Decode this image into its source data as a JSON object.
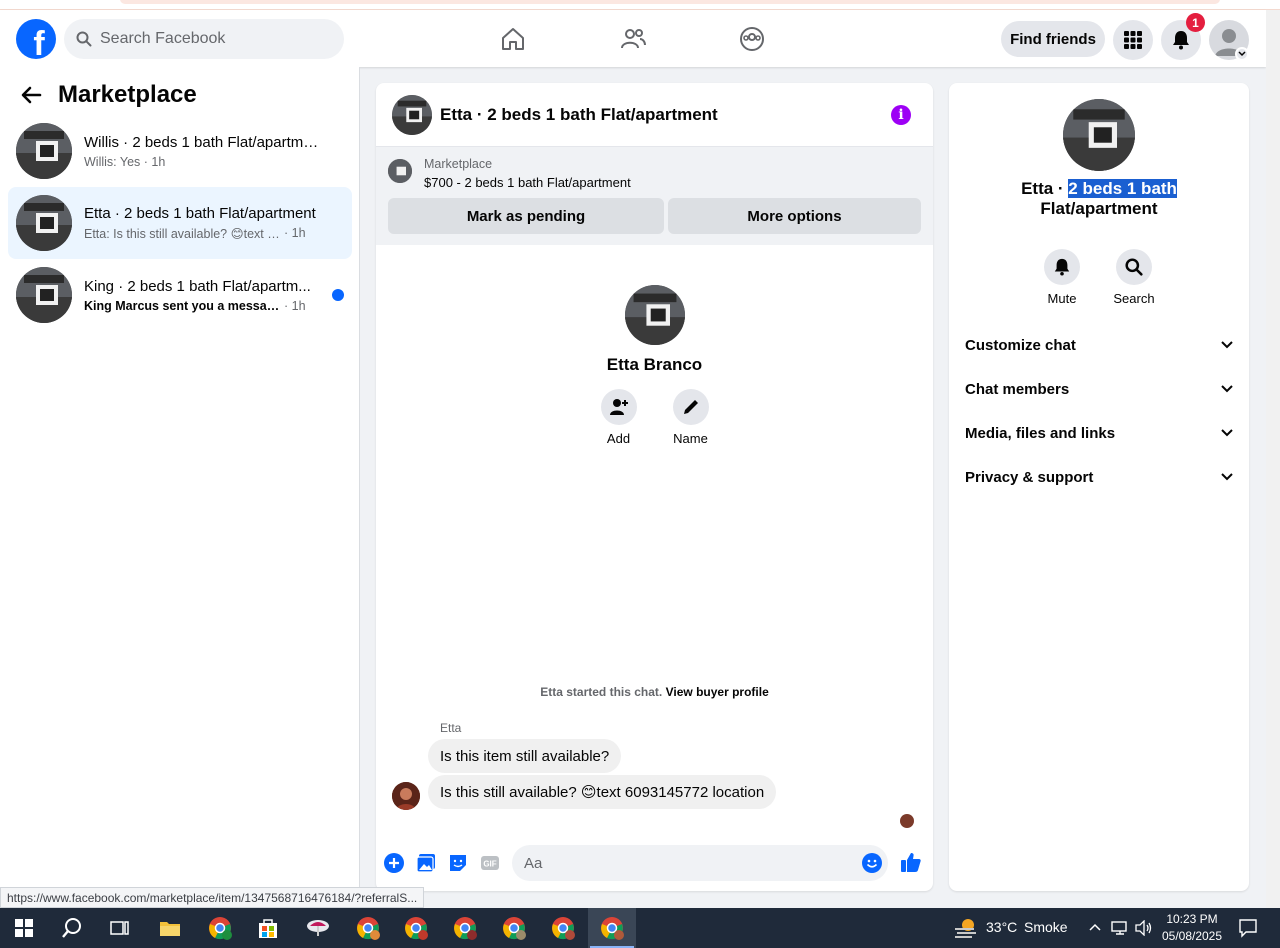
{
  "header": {
    "logo": "f",
    "search_placeholder": "Search Facebook",
    "find_friends": "Find friends",
    "notification_count": "1"
  },
  "sidebar": {
    "title": "Marketplace",
    "conversations": [
      {
        "title": "Willis · 2 beds 1 bath Flat/apartment",
        "subtitle": "Willis: Yes · 1h",
        "active": false,
        "unread": false
      },
      {
        "title": "Etta · 2 beds 1 bath Flat/apartment",
        "subtitle": "Etta: Is this still available? 😊text 609...",
        "time": " · 1h",
        "active": true,
        "unread": false
      },
      {
        "title": "King · 2 beds 1 bath Flat/apartm...",
        "subtitle": "King Marcus sent you a message a...",
        "time": " · 1h",
        "active": false,
        "unread": true
      }
    ]
  },
  "chat": {
    "title": "Etta · 2 beds 1 bath Flat/apartment",
    "listing_label": "Marketplace",
    "listing_price": "$700 - 2 beds 1 bath Flat/apartment",
    "mark_pending": "Mark as pending",
    "more_options": "More options",
    "profile_name": "Etta Branco",
    "add_label": "Add",
    "name_label": "Name",
    "started_text": "Etta started this chat.",
    "view_profile": "View buyer profile",
    "sender": "Etta",
    "messages": [
      "Is this item still available?",
      "Is this still available? 😊text 6093145772 location"
    ],
    "composer_placeholder": "Aa"
  },
  "details": {
    "title_prefix": "Etta · ",
    "title_selected": "2 beds 1 bath",
    "title_suffix": "Flat/apartment",
    "mute": "Mute",
    "search": "Search",
    "sections": [
      "Customize chat",
      "Chat members",
      "Media, files and links",
      "Privacy & support"
    ]
  },
  "status_url": "https://www.facebook.com/marketplace/item/1347568716476184/?referralS...",
  "taskbar": {
    "temperature": "33°C",
    "weather": "Smoke",
    "time": "10:23 PM",
    "date": "05/08/2025"
  },
  "colors": {
    "brand": "#0866ff",
    "active_conv": "#ebf5ff",
    "info": "#9d00f5",
    "badge": "#e41e3f",
    "selection": "#1a5fd1",
    "taskbar": "#1f2a3a"
  }
}
